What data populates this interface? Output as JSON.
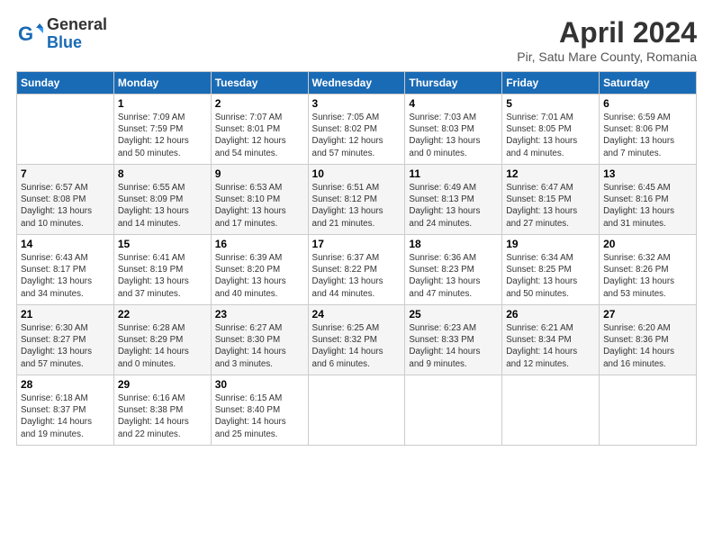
{
  "logo": {
    "general": "General",
    "blue": "Blue"
  },
  "title": "April 2024",
  "subtitle": "Pir, Satu Mare County, Romania",
  "days_header": [
    "Sunday",
    "Monday",
    "Tuesday",
    "Wednesday",
    "Thursday",
    "Friday",
    "Saturday"
  ],
  "weeks": [
    [
      {
        "day": "",
        "info": ""
      },
      {
        "day": "1",
        "info": "Sunrise: 7:09 AM\nSunset: 7:59 PM\nDaylight: 12 hours\nand 50 minutes."
      },
      {
        "day": "2",
        "info": "Sunrise: 7:07 AM\nSunset: 8:01 PM\nDaylight: 12 hours\nand 54 minutes."
      },
      {
        "day": "3",
        "info": "Sunrise: 7:05 AM\nSunset: 8:02 PM\nDaylight: 12 hours\nand 57 minutes."
      },
      {
        "day": "4",
        "info": "Sunrise: 7:03 AM\nSunset: 8:03 PM\nDaylight: 13 hours\nand 0 minutes."
      },
      {
        "day": "5",
        "info": "Sunrise: 7:01 AM\nSunset: 8:05 PM\nDaylight: 13 hours\nand 4 minutes."
      },
      {
        "day": "6",
        "info": "Sunrise: 6:59 AM\nSunset: 8:06 PM\nDaylight: 13 hours\nand 7 minutes."
      }
    ],
    [
      {
        "day": "7",
        "info": "Sunrise: 6:57 AM\nSunset: 8:08 PM\nDaylight: 13 hours\nand 10 minutes."
      },
      {
        "day": "8",
        "info": "Sunrise: 6:55 AM\nSunset: 8:09 PM\nDaylight: 13 hours\nand 14 minutes."
      },
      {
        "day": "9",
        "info": "Sunrise: 6:53 AM\nSunset: 8:10 PM\nDaylight: 13 hours\nand 17 minutes."
      },
      {
        "day": "10",
        "info": "Sunrise: 6:51 AM\nSunset: 8:12 PM\nDaylight: 13 hours\nand 21 minutes."
      },
      {
        "day": "11",
        "info": "Sunrise: 6:49 AM\nSunset: 8:13 PM\nDaylight: 13 hours\nand 24 minutes."
      },
      {
        "day": "12",
        "info": "Sunrise: 6:47 AM\nSunset: 8:15 PM\nDaylight: 13 hours\nand 27 minutes."
      },
      {
        "day": "13",
        "info": "Sunrise: 6:45 AM\nSunset: 8:16 PM\nDaylight: 13 hours\nand 31 minutes."
      }
    ],
    [
      {
        "day": "14",
        "info": "Sunrise: 6:43 AM\nSunset: 8:17 PM\nDaylight: 13 hours\nand 34 minutes."
      },
      {
        "day": "15",
        "info": "Sunrise: 6:41 AM\nSunset: 8:19 PM\nDaylight: 13 hours\nand 37 minutes."
      },
      {
        "day": "16",
        "info": "Sunrise: 6:39 AM\nSunset: 8:20 PM\nDaylight: 13 hours\nand 40 minutes."
      },
      {
        "day": "17",
        "info": "Sunrise: 6:37 AM\nSunset: 8:22 PM\nDaylight: 13 hours\nand 44 minutes."
      },
      {
        "day": "18",
        "info": "Sunrise: 6:36 AM\nSunset: 8:23 PM\nDaylight: 13 hours\nand 47 minutes."
      },
      {
        "day": "19",
        "info": "Sunrise: 6:34 AM\nSunset: 8:25 PM\nDaylight: 13 hours\nand 50 minutes."
      },
      {
        "day": "20",
        "info": "Sunrise: 6:32 AM\nSunset: 8:26 PM\nDaylight: 13 hours\nand 53 minutes."
      }
    ],
    [
      {
        "day": "21",
        "info": "Sunrise: 6:30 AM\nSunset: 8:27 PM\nDaylight: 13 hours\nand 57 minutes."
      },
      {
        "day": "22",
        "info": "Sunrise: 6:28 AM\nSunset: 8:29 PM\nDaylight: 14 hours\nand 0 minutes."
      },
      {
        "day": "23",
        "info": "Sunrise: 6:27 AM\nSunset: 8:30 PM\nDaylight: 14 hours\nand 3 minutes."
      },
      {
        "day": "24",
        "info": "Sunrise: 6:25 AM\nSunset: 8:32 PM\nDaylight: 14 hours\nand 6 minutes."
      },
      {
        "day": "25",
        "info": "Sunrise: 6:23 AM\nSunset: 8:33 PM\nDaylight: 14 hours\nand 9 minutes."
      },
      {
        "day": "26",
        "info": "Sunrise: 6:21 AM\nSunset: 8:34 PM\nDaylight: 14 hours\nand 12 minutes."
      },
      {
        "day": "27",
        "info": "Sunrise: 6:20 AM\nSunset: 8:36 PM\nDaylight: 14 hours\nand 16 minutes."
      }
    ],
    [
      {
        "day": "28",
        "info": "Sunrise: 6:18 AM\nSunset: 8:37 PM\nDaylight: 14 hours\nand 19 minutes."
      },
      {
        "day": "29",
        "info": "Sunrise: 6:16 AM\nSunset: 8:38 PM\nDaylight: 14 hours\nand 22 minutes."
      },
      {
        "day": "30",
        "info": "Sunrise: 6:15 AM\nSunset: 8:40 PM\nDaylight: 14 hours\nand 25 minutes."
      },
      {
        "day": "",
        "info": ""
      },
      {
        "day": "",
        "info": ""
      },
      {
        "day": "",
        "info": ""
      },
      {
        "day": "",
        "info": ""
      }
    ]
  ]
}
